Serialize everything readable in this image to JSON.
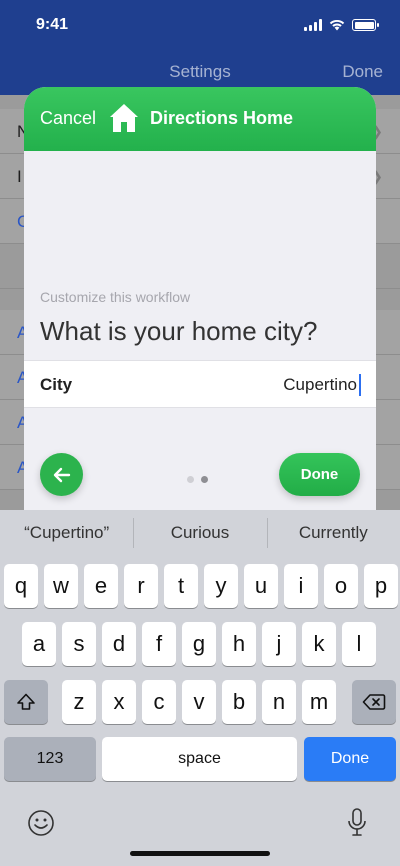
{
  "status_bar": {
    "time": "9:41"
  },
  "background_screen": {
    "title": "Settings",
    "done_label": "Done",
    "rows": [
      {
        "initial": "N",
        "style": "dark",
        "chevron": true
      },
      {
        "initial": "I",
        "style": "dark",
        "chevron": true
      },
      {
        "initial": "C",
        "style": "blue",
        "chevron": false
      },
      {
        "initial": "",
        "style": "spacer",
        "chevron": false
      },
      {
        "initial": "A",
        "style": "blue",
        "chevron": false
      },
      {
        "initial": "A",
        "style": "blue",
        "chevron": false
      },
      {
        "initial": "A",
        "style": "blue",
        "chevron": false
      },
      {
        "initial": "A",
        "style": "blue",
        "chevron": false
      }
    ]
  },
  "modal": {
    "cancel_label": "Cancel",
    "title": "Directions Home",
    "customize_label": "Customize this workflow",
    "question": "What is your home city?",
    "field_label": "City",
    "field_value": "Cupertino",
    "done_label": "Done",
    "page_count": 2,
    "current_page": 2,
    "accent_color": "#2cb34d"
  },
  "keyboard": {
    "suggestions": [
      "“Cupertino”",
      "Curious",
      "Currently"
    ],
    "row1": [
      "q",
      "w",
      "e",
      "r",
      "t",
      "y",
      "u",
      "i",
      "o",
      "p"
    ],
    "row2": [
      "a",
      "s",
      "d",
      "f",
      "g",
      "h",
      "j",
      "k",
      "l"
    ],
    "row3": [
      "z",
      "x",
      "c",
      "v",
      "b",
      "n",
      "m"
    ],
    "numbers_label": "123",
    "space_label": "space",
    "return_label": "Done",
    "shift_icon": "shift-icon",
    "delete_icon": "delete-backspace-icon",
    "emoji_icon": "emoji-icon",
    "mic_icon": "microphone-icon"
  }
}
